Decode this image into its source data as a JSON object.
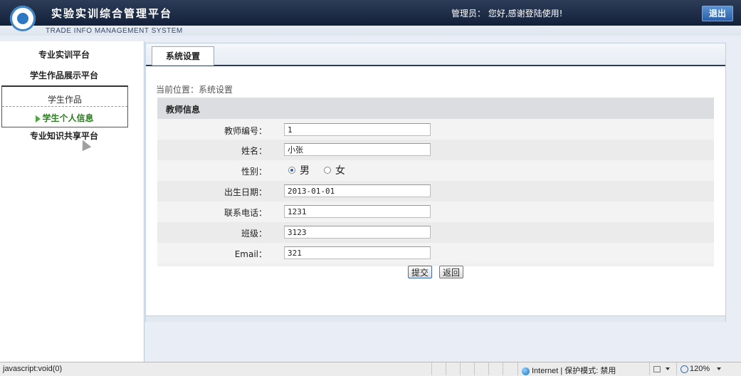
{
  "header": {
    "title": "实验实训综合管理平台",
    "subtitle": "TRADE INFO MANAGEMENT SYSTEM",
    "admin_label": "管理员：",
    "welcome": "您好,感谢登陆使用!",
    "logout_label": "退出"
  },
  "sidebar": {
    "items": [
      {
        "label": "专业实训平台"
      },
      {
        "label": "学生作品展示平台"
      },
      {
        "label": "专业知识共享平台"
      }
    ],
    "sub_items": [
      {
        "label": "学生作品"
      },
      {
        "label": "学生个人信息"
      }
    ]
  },
  "main": {
    "tab_label": "系统设置",
    "breadcrumb": "当前位置：系统设置",
    "section_title": "教师信息",
    "fields": {
      "teacher_id": {
        "label": "教师编号：",
        "value": "1"
      },
      "name": {
        "label": "姓名：",
        "value": "小张"
      },
      "gender": {
        "label": "性别：",
        "options": [
          "男",
          "女"
        ],
        "selected": "男"
      },
      "birth_date": {
        "label": "出生日期：",
        "value": "2013-01-01"
      },
      "phone": {
        "label": "联系电话：",
        "value": "1231"
      },
      "class": {
        "label": "班级：",
        "value": "3123"
      },
      "email": {
        "label": "Email：",
        "value": "321"
      }
    },
    "submit_label": "提交",
    "back_label": "返回"
  },
  "statusbar": {
    "url": "javascript:void(0)",
    "zone": "Internet | 保护模式: 禁用",
    "zoom": "120%"
  }
}
